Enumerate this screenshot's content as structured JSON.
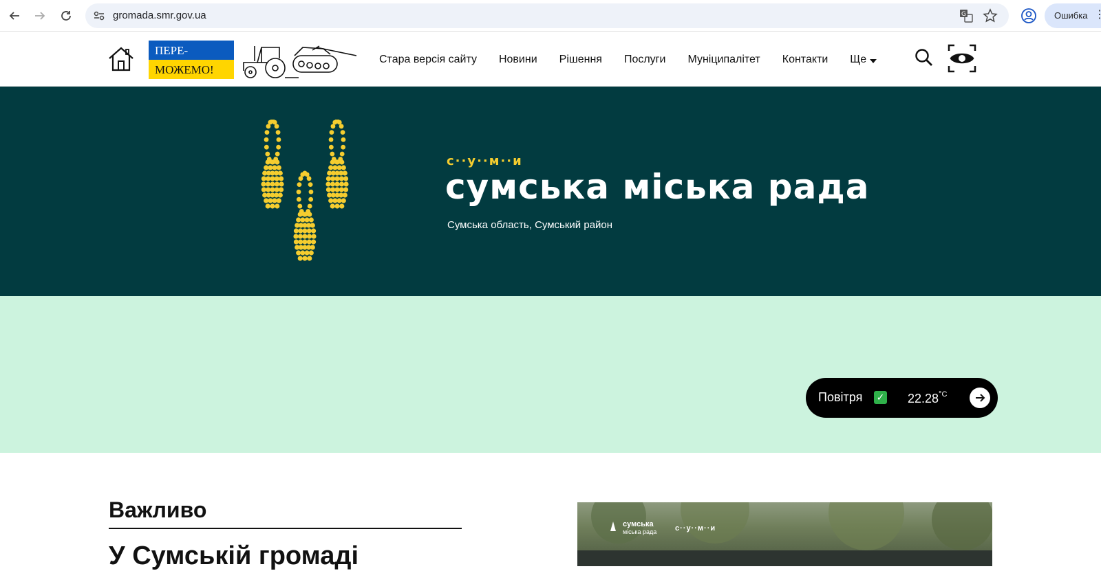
{
  "browser": {
    "url": "gromada.smr.gov.ua",
    "error_chip": "Ошибка"
  },
  "header": {
    "banner_top": "ПЕРЕ-",
    "banner_bottom": "МОЖЕМО!",
    "nav": [
      "Стара версія сайту",
      "Новини",
      "Рішення",
      "Послуги",
      "Муніципалітет",
      "Контакти"
    ],
    "more_label": "Ще"
  },
  "hero": {
    "small_logo": "с··у··м··и",
    "title": "сумська міська рада",
    "subtitle": "Сумська область, Сумський район"
  },
  "air": {
    "label": "Повітря",
    "temperature": "22.28",
    "unit": "°C"
  },
  "content": {
    "section_heading": "Важливо",
    "news_title": "У Сумській громаді",
    "image_logo_line1": "сумська",
    "image_logo_line2": "міська рада",
    "image_logo_sumy": "с··у··м··и"
  },
  "colors": {
    "hero_bg": "#023b40",
    "accent_yellow": "#f5cd2f",
    "mint_bg": "#ccf3de"
  }
}
